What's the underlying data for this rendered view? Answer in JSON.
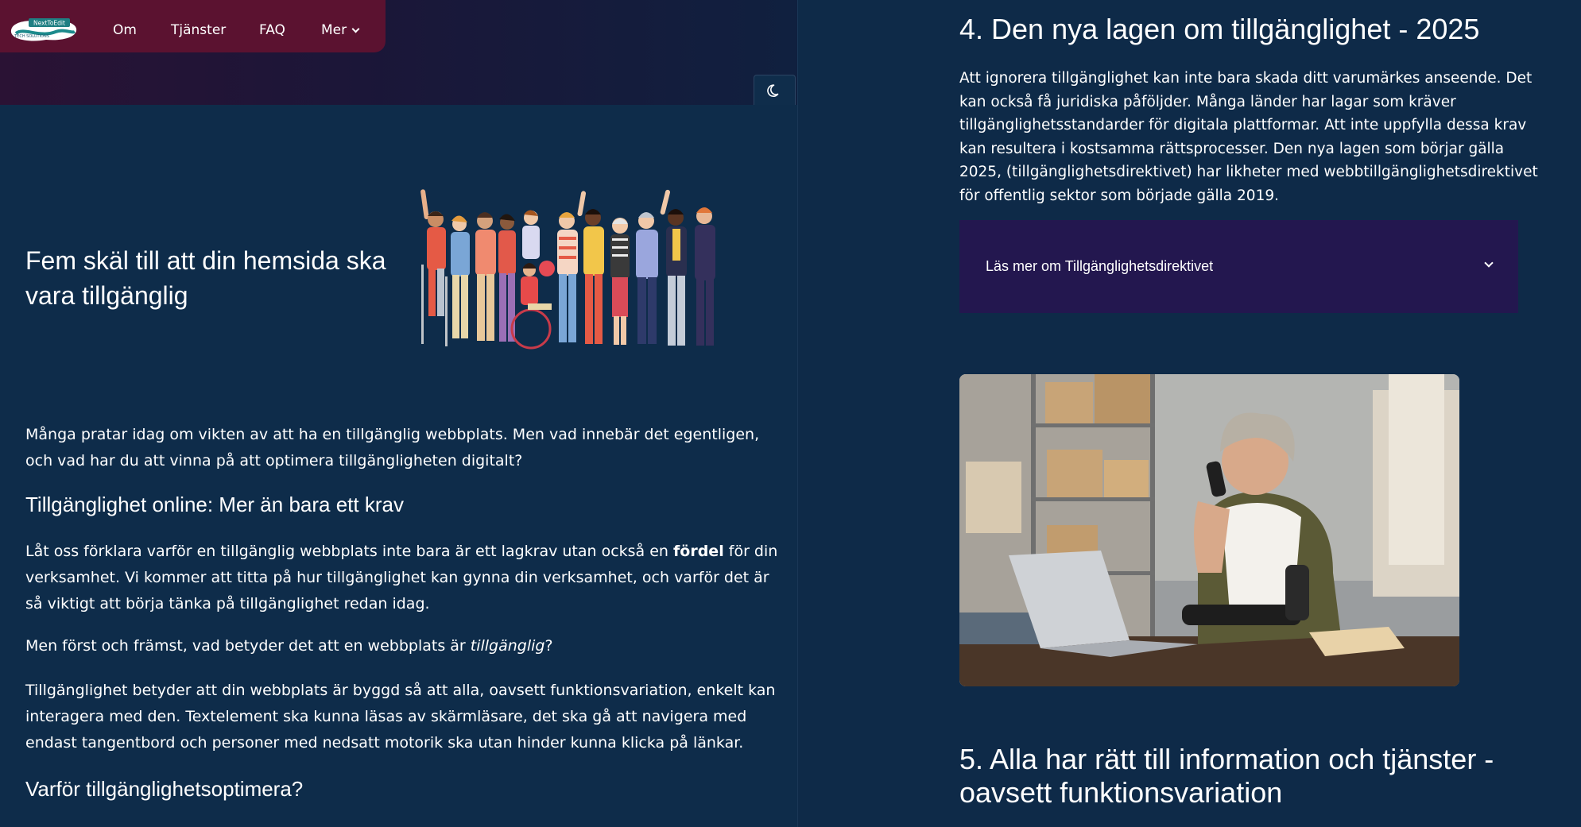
{
  "nav": {
    "logo_text_top": "NextToEdit",
    "logo_text_bottom": "TECH SOLUTIONS",
    "items": [
      {
        "label": "Om"
      },
      {
        "label": "Tjänster"
      },
      {
        "label": "FAQ"
      },
      {
        "label": "Mer"
      }
    ],
    "theme_icon": "moon-icon",
    "dropdown_icon": "chevron-down-icon"
  },
  "hero": {
    "title": "Fem skäl till att din hemsida ska vara tillgänglig",
    "illustration": "diverse-people-group-illustration"
  },
  "article": {
    "intro": "Många pratar idag om vikten av att ha en tillgänglig webbplats. Men vad innebär det egentligen, och vad har du att vinna på att optimera tillgängligheten digitalt?",
    "h2_online": "Tillgänglighet online: Mer än bara ett krav",
    "p1_before": "Låt oss förklara varför en tillgänglig webbplats inte bara är ett lagkrav utan också en ",
    "p1_bold": "fördel",
    "p1_after": " för din verksamhet. Vi kommer att titta på hur tillgänglighet kan gynna din verksamhet, och varför det är så viktigt att börja tänka på tillgänglighet redan idag.",
    "p2_before": "Men först och främst, vad betyder det att en webbplats är ",
    "p2_italic": "tillgänglig",
    "p2_after": "?",
    "p3": "Tillgänglighet betyder att din webbplats är byggd så att alla, oavsett funktionsvariation, enkelt kan interagera med den. Textelement ska kunna läsas av skärmläsare, det ska gå att navigera med endast tangentbord och personer med nedsatt motorik ska utan hinder kunna klicka på länkar.",
    "h2_why": "Varför tillgänglighetsoptimera?"
  },
  "right": {
    "h2_law": "4. Den nya lagen om tillgänglighet - 2025",
    "law_paragraph": "Att ignorera tillgänglighet kan inte bara skada ditt varumärkes anseende. Det kan också få juridiska påföljder. Många länder har lagar som kräver tillgänglighetsstandarder för digitala plattformar. Att inte uppfylla dessa krav kan resultera i kostsamma rättsprocesser. Den nya lagen som börjar gälla 2025, (tillgänglighetsdirektivet) har likheter med webbtillgänglighetsdirektivet för offentlig sektor som började gälla 2019.",
    "accordion_label": "Läs mer om Tillgänglighetsdirektivet",
    "photo": "woman-with-prosthetic-arm-on-phone-at-laptop",
    "h2_rights": "5. Alla har rätt till information och tjänster - oavsett funktionsvariation"
  },
  "colors": {
    "background": "#0e2c4a",
    "nav_pill": "#5b1230",
    "accordion_bg": "#23174f"
  }
}
